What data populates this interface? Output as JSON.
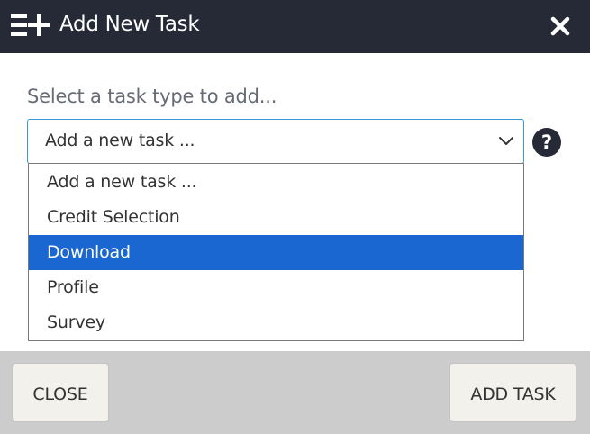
{
  "header": {
    "title": "Add New Task",
    "icon": "list-add-icon",
    "close_icon": "close-icon"
  },
  "form": {
    "label": "Select a task type to add...",
    "select": {
      "value": "Add a new task ...",
      "options": [
        "Add a new task ...",
        "Credit Selection",
        "Download",
        "Profile",
        "Survey"
      ],
      "highlighted": "Download"
    },
    "help_icon": "help-circle-icon"
  },
  "footer": {
    "close_label": "CLOSE",
    "add_label": "ADD TASK"
  },
  "colors": {
    "header_bg": "#252a36",
    "select_border": "#3a97d6",
    "option_highlight": "#1a67d1",
    "footer_bg": "#cccccc",
    "button_bg": "#f2f1ec"
  }
}
